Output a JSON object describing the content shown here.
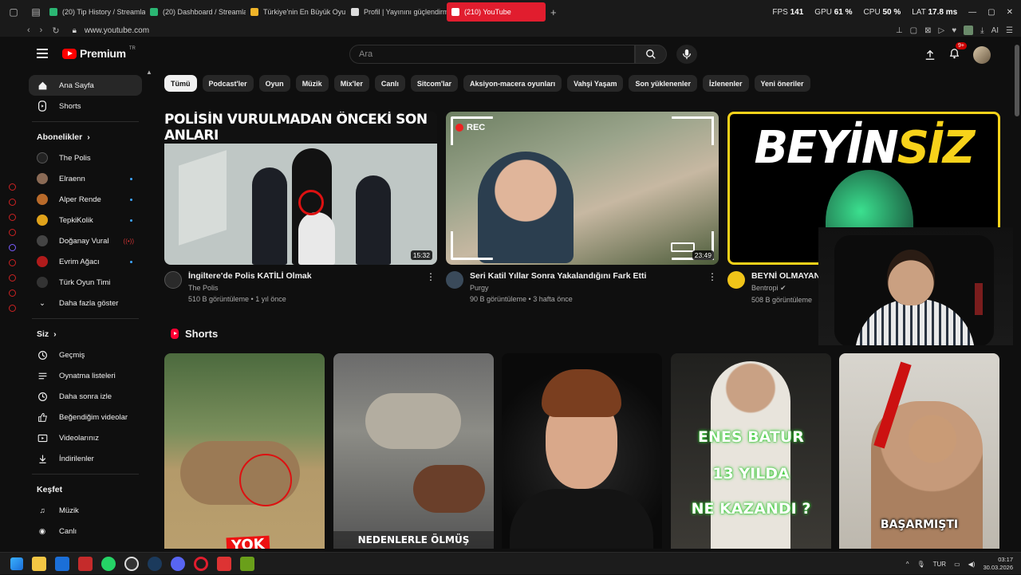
{
  "browser": {
    "tabs": [
      {
        "label": "(20) Tip History / Streamla",
        "color": "#2bb673"
      },
      {
        "label": "(20) Dashboard / Streamla",
        "color": "#2bb673"
      },
      {
        "label": "Türkiye'nin En Büyük Oyu",
        "color": "#f0b429"
      },
      {
        "label": "Profil | Yayınını güçlendirm",
        "color": "#dddddd"
      },
      {
        "label": "(210) YouTube",
        "color": "#ff0000",
        "active": true
      }
    ],
    "url": "www.youtube.com",
    "stats": {
      "fps_label": "FPS",
      "fps": "141",
      "gpu_label": "GPU",
      "gpu": "61 %",
      "cpu_label": "CPU",
      "cpu": "50 %",
      "lat_label": "LAT",
      "lat": "17.8 ms"
    }
  },
  "header": {
    "logo_text": "Premium",
    "logo_sup": "TR",
    "search_placeholder": "Ara",
    "notifications_badge": "9+"
  },
  "sidebar": {
    "main": [
      {
        "label": "Ana Sayfa",
        "icon": "home-icon",
        "active": true
      },
      {
        "label": "Shorts",
        "icon": "shorts-icon"
      }
    ],
    "subscriptions_title": "Abonelikler",
    "subscriptions": [
      {
        "label": "The Polis",
        "color": "#222222",
        "indicator": ""
      },
      {
        "label": "Elraenn",
        "color": "#8a6a55",
        "indicator": "dot"
      },
      {
        "label": "Alper Rende",
        "color": "#b86a2a",
        "indicator": "dot"
      },
      {
        "label": "TepkiKolik",
        "color": "#e0a21a",
        "indicator": "dot"
      },
      {
        "label": "Doğanay Vural",
        "color": "#444444",
        "indicator": "live"
      },
      {
        "label": "Evrim Ağacı",
        "color": "#b01b1b",
        "indicator": "dot"
      },
      {
        "label": "Türk Oyun Timi",
        "color": "#333333",
        "indicator": ""
      }
    ],
    "show_more": "Daha fazla göster",
    "you_title": "Siz",
    "you": [
      {
        "label": "Geçmiş",
        "icon": "history-icon"
      },
      {
        "label": "Oynatma listeleri",
        "icon": "playlists-icon"
      },
      {
        "label": "Daha sonra izle",
        "icon": "watch-later-icon"
      },
      {
        "label": "Beğendiğim videolar",
        "icon": "liked-videos-icon"
      },
      {
        "label": "Videolarınız",
        "icon": "your-videos-icon"
      },
      {
        "label": "İndirilenler",
        "icon": "downloads-icon"
      }
    ],
    "explore_title": "Keşfet",
    "explore": [
      {
        "label": "Müzik",
        "icon": "music-icon"
      },
      {
        "label": "Canlı",
        "icon": "live-icon"
      }
    ]
  },
  "chips": [
    "Tümü",
    "Podcast'ler",
    "Oyun",
    "Müzik",
    "Mix'ler",
    "Canlı",
    "Sitcom'lar",
    "Aksiyon-macera oyunları",
    "Vahşi Yaşam",
    "Son yüklenenler",
    "İzlenenler",
    "Yeni öneriler"
  ],
  "videos": [
    {
      "thumb_text": "POLİSİN VURULMADAN ÖNCEKİ SON ANLARI",
      "duration": "15:32",
      "title": "İngiltere'de Polis KATİLİ Olmak",
      "channel": "The Polis",
      "stats": "510 B görüntüleme • 1 yıl önce",
      "avatar_color": "#2a2a2a"
    },
    {
      "thumb_text": "REC",
      "duration": "23:49",
      "title": "Seri Katil Yıllar Sonra Yakalandığını Fark Etti",
      "channel": "Purgy",
      "stats": "90 B görüntüleme • 3 hafta önce",
      "avatar_color": "#3a4a5a"
    },
    {
      "thumb_text_a": "BEYİN",
      "thumb_text_b": "SİZ",
      "title": "BEYNİ OLMAYAN",
      "channel": "Bentropi",
      "stats": "508 B görüntüleme",
      "avatar_color": "#f0c419"
    }
  ],
  "shorts": {
    "title": "Shorts",
    "items": [
      {
        "caption": "YOK"
      },
      {
        "caption": "NEDENLERLE ÖLMÜŞ"
      },
      {
        "caption": ""
      },
      {
        "caption_l1": "ENES BATUR",
        "caption_l2": "13 YILDA",
        "caption_l3": "NE KAZANDI ?"
      },
      {
        "caption": "BAŞARMIŞTI"
      }
    ]
  },
  "taskbar": {
    "lang": "TUR",
    "time": "03:17",
    "date": "30.03.2026"
  }
}
